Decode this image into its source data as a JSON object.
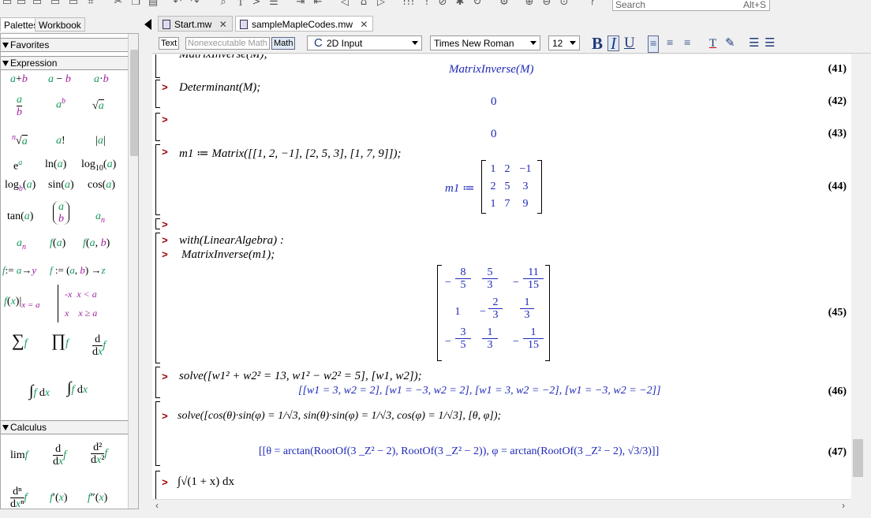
{
  "toolbar": {
    "icons": [
      "new-icon",
      "open-icon",
      "save-icon",
      "print-icon",
      "print-preview-icon",
      "crop-icon",
      "undo-icon",
      "redo-icon",
      "cut-icon",
      "copy-icon",
      "paste-icon",
      "find-icon",
      "text-icon",
      "math-prompt-icon",
      "section-icon",
      "indent-icon",
      "outdent-icon",
      "back-icon",
      "home-icon",
      "forward-icon",
      "execute-all-icon",
      "stop-icon",
      "debug-icon",
      "restart-icon",
      "assistant-icon",
      "zoom-in-icon",
      "zoom-out-icon",
      "zoom-fit-icon",
      "help-icon"
    ],
    "search_placeholder": "Search",
    "search_shortcut": "Alt+S"
  },
  "left_panel": {
    "tabs": [
      "Palettes",
      "Workbook"
    ],
    "sections": {
      "favorites": "Favorites",
      "expression": "Expression",
      "calculus": "Calculus"
    }
  },
  "doc_tabs": [
    {
      "label": "Start.mw",
      "close": "✕"
    },
    {
      "label": "sampleMapleCodes.mw",
      "close": "✕"
    }
  ],
  "format_bar": {
    "text_mode": "Text",
    "nonexec_mode": "Nonexecutable Math",
    "math_mode": "Math",
    "input_mode": "2D Input",
    "font": "Times New Roman",
    "size": "12"
  },
  "worksheet": {
    "prompt": ">",
    "lines": {
      "l41_input_cut": "MatrixInverse(M);",
      "l41_out": "MatrixInverse(M)",
      "l41_label": "(41)",
      "l42_input": "Determinant(M);",
      "l42_out": "0",
      "l42_label": "(42)",
      "l43_out": "0",
      "l43_label": "(43)",
      "l44_input": "m1 ≔ Matrix([[1, 2, −1], [2, 5, 3], [1, 7, 9]]);",
      "l44_lhs": "m1 ≔",
      "l44_matrix": [
        [
          "1",
          "2",
          "−1"
        ],
        [
          "2",
          "5",
          "3"
        ],
        [
          "1",
          "7",
          "9"
        ]
      ],
      "l44_label": "(44)",
      "with_input": "with(LinearAlgebra) :",
      "inv_input": "MatrixInverse(m1);",
      "l45_matrix": [
        [
          {
            "s": "−",
            "n": "8",
            "d": "5"
          },
          {
            "s": "",
            "n": "5",
            "d": "3"
          },
          {
            "s": "−",
            "n": "11",
            "d": "15"
          }
        ],
        [
          {
            "s": "",
            "v": "1"
          },
          {
            "s": "−",
            "n": "2",
            "d": "3"
          },
          {
            "s": "",
            "n": "1",
            "d": "3"
          }
        ],
        [
          {
            "s": "−",
            "n": "3",
            "d": "5"
          },
          {
            "s": "",
            "n": "1",
            "d": "3"
          },
          {
            "s": "−",
            "n": "1",
            "d": "15"
          }
        ]
      ],
      "l45_label": "(45)",
      "l46_input": "solve([w1² + w2² = 13, w1² − w2² = 5], [w1, w2]);",
      "l46_out": "[[w1 = 3, w2 = 2], [w1 = −3, w2 = 2], [w1 = 3, w2 = −2], [w1 = −3, w2 = −2]]",
      "l46_label": "(46)",
      "l47_input": "solve([cos(θ)·sin(φ) = 1/√3, sin(θ)·sin(φ) = 1/√3, cos(φ) = 1/√3], [θ, φ]);",
      "l47_out": "[[θ = arctan(RootOf(3 _Z² − 2), RootOf(3 _Z² − 2)), φ = arctan(RootOf(3 _Z² − 2), √3/3)]]",
      "l47_label": "(47)",
      "l48_input": "∫√(1 + x) dx"
    }
  }
}
